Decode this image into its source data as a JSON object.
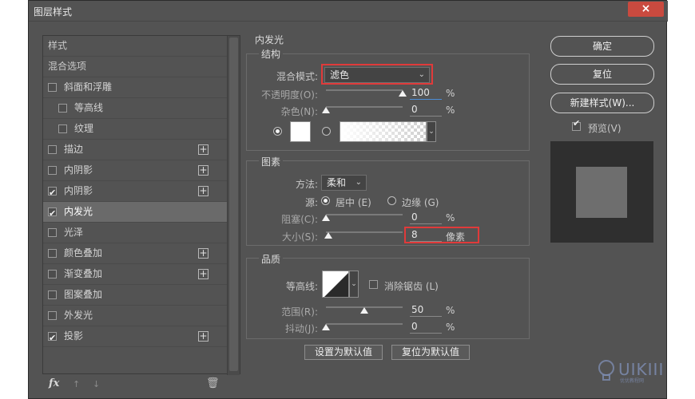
{
  "window": {
    "title": "图层样式",
    "close_label": "×"
  },
  "styles_list": {
    "items": [
      {
        "label": "样式",
        "type": "header"
      },
      {
        "label": "混合选项",
        "type": "header"
      },
      {
        "label": "斜面和浮雕",
        "checked": false,
        "indent": 0,
        "plus": false
      },
      {
        "label": "等高线",
        "checked": false,
        "indent": 1,
        "plus": false
      },
      {
        "label": "纹理",
        "checked": false,
        "indent": 1,
        "plus": false
      },
      {
        "label": "描边",
        "checked": false,
        "indent": 0,
        "plus": true
      },
      {
        "label": "内阴影",
        "checked": false,
        "indent": 0,
        "plus": true
      },
      {
        "label": "内阴影",
        "checked": true,
        "indent": 0,
        "plus": true
      },
      {
        "label": "内发光",
        "checked": true,
        "indent": 0,
        "plus": false,
        "selected": true
      },
      {
        "label": "光泽",
        "checked": false,
        "indent": 0,
        "plus": false
      },
      {
        "label": "颜色叠加",
        "checked": false,
        "indent": 0,
        "plus": true
      },
      {
        "label": "渐变叠加",
        "checked": false,
        "indent": 0,
        "plus": true
      },
      {
        "label": "图案叠加",
        "checked": false,
        "indent": 0,
        "plus": false
      },
      {
        "label": "外发光",
        "checked": false,
        "indent": 0,
        "plus": false
      },
      {
        "label": "投影",
        "checked": true,
        "indent": 0,
        "plus": true
      }
    ],
    "bottom": {
      "fx_label": "fx",
      "up_icon": "↑",
      "down_icon": "↓",
      "trash_icon": "🗑"
    }
  },
  "inner_glow": {
    "title": "内发光",
    "structure": {
      "title": "结构",
      "blend_mode_label": "混合模式:",
      "blend_mode_value": "滤色",
      "opacity_label": "不透明度(O):",
      "opacity_value": "100",
      "opacity_fraction": 1.0,
      "noise_label": "杂色(N):",
      "noise_value": "0",
      "noise_fraction": 0.0,
      "unit_percent": "%",
      "color_mode": "solid",
      "glow_color": "#ffffff"
    },
    "elements": {
      "title": "图素",
      "method_label": "方法:",
      "method_value": "柔和",
      "source_label": "源:",
      "source_center_label": "居中 (E)",
      "source_edge_label": "边缘 (G)",
      "source_selected": "center",
      "choke_label": "阻塞(C):",
      "choke_value": "0",
      "choke_fraction": 0.0,
      "size_label": "大小(S):",
      "size_value": "8",
      "size_unit": "像素",
      "size_fraction": 0.03
    },
    "quality": {
      "title": "品质",
      "contour_label": "等高线:",
      "antialias_label": "消除锯齿 (L)",
      "antialias_checked": false,
      "range_label": "范围(R):",
      "range_value": "50",
      "range_fraction": 0.5,
      "jitter_label": "抖动(J):",
      "jitter_value": "0",
      "jitter_fraction": 0.0
    },
    "set_default_label": "设置为默认值",
    "reset_default_label": "复位为默认值"
  },
  "actions": {
    "ok_label": "确定",
    "reset_label": "复位",
    "new_style_label": "新建样式(W)...",
    "preview_label": "预览(V)",
    "preview_checked": true
  },
  "watermark": {
    "text": "UIKIII",
    "sub": "优优教程网"
  },
  "colors": {
    "dialog_bg": "#535353",
    "highlight": "#e03a3a",
    "accent": "#4c8ed8"
  }
}
